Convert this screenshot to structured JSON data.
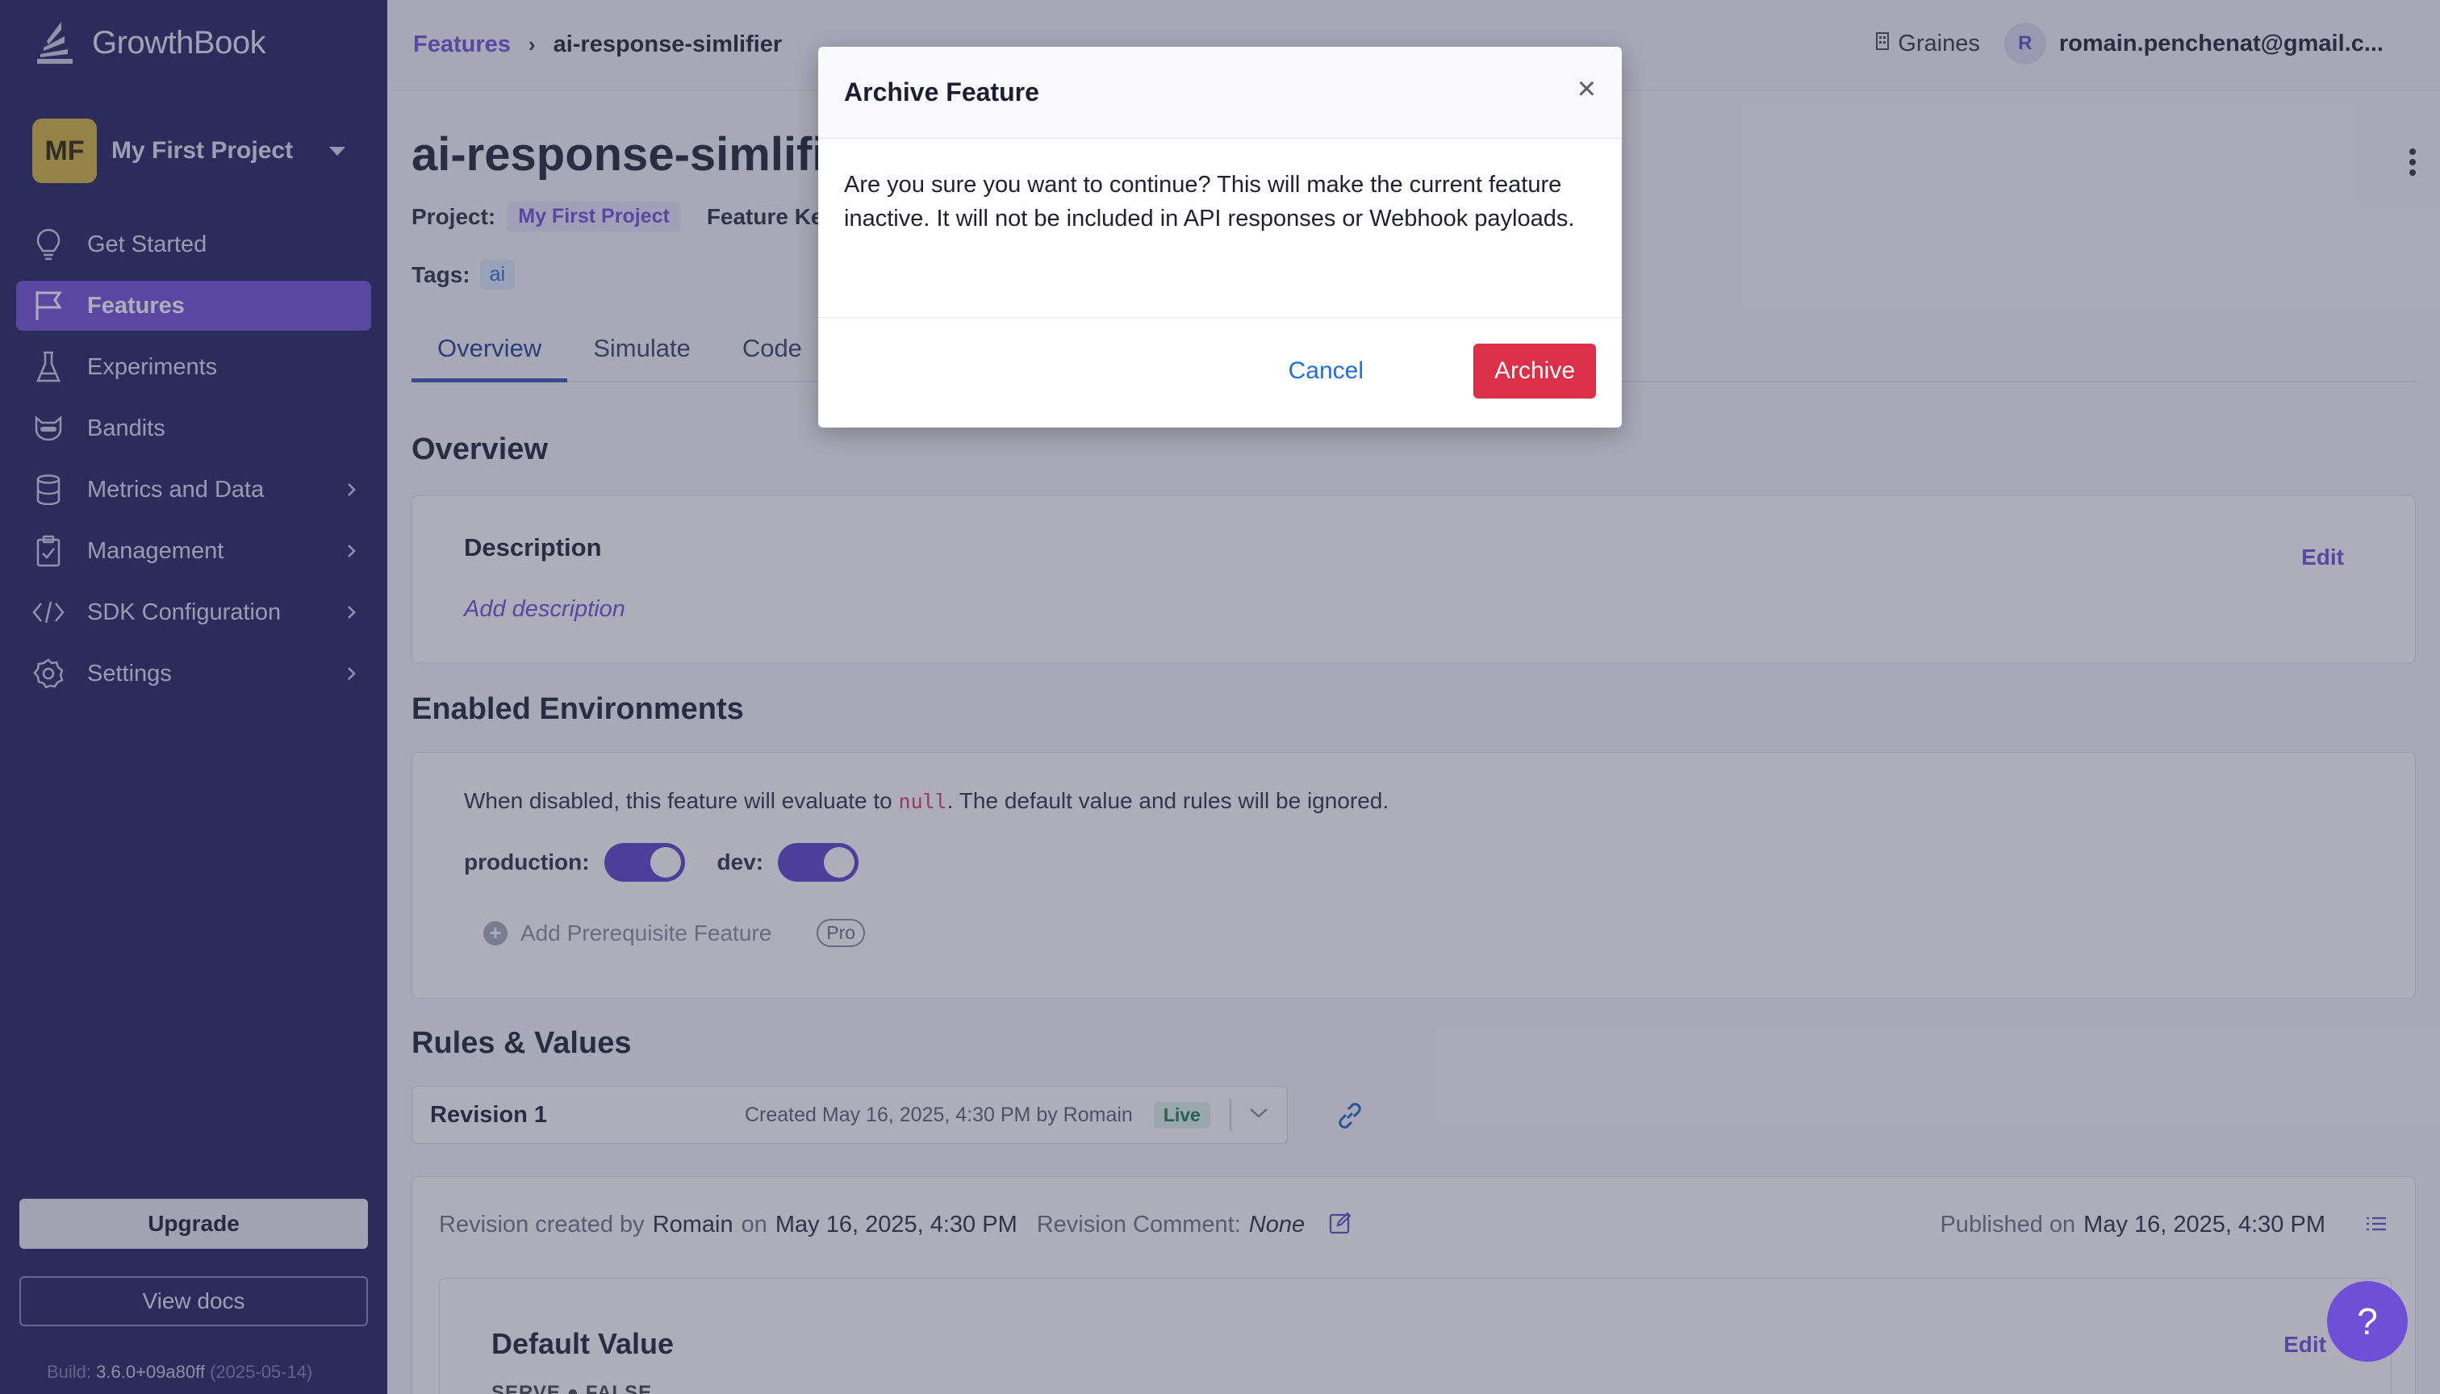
{
  "sidebar": {
    "logo_text": "GrowthBook",
    "project_initials": "MF",
    "project_name": "My First Project",
    "items": [
      {
        "label": "Get Started"
      },
      {
        "label": "Features"
      },
      {
        "label": "Experiments"
      },
      {
        "label": "Bandits"
      },
      {
        "label": "Metrics and Data"
      },
      {
        "label": "Management"
      },
      {
        "label": "SDK Configuration"
      },
      {
        "label": "Settings"
      }
    ],
    "upgrade_label": "Upgrade",
    "docs_label": "View docs",
    "build_prefix": "Build:",
    "build_version": "3.6.0+09a80ff",
    "build_date": "(2025-05-14)"
  },
  "topbar": {
    "breadcrumb_root": "Features",
    "breadcrumb_current": "ai-response-simlifier",
    "org_name": "Graines",
    "user_initial": "R",
    "user_email": "romain.penchenat@gmail.c..."
  },
  "feature": {
    "title": "ai-response-simlifi",
    "project_label": "Project:",
    "project_value": "My First Project",
    "feature_key_label": "Feature Key",
    "tags_label": "Tags:",
    "tags": [
      "ai"
    ]
  },
  "tabs": [
    {
      "label": "Overview"
    },
    {
      "label": "Simulate"
    },
    {
      "label": "Code"
    }
  ],
  "overview": {
    "section_title": "Overview",
    "description_title": "Description",
    "description_placeholder": "Add description",
    "edit_label": "Edit"
  },
  "environments": {
    "section_title": "Enabled Environments",
    "text_before": "When disabled, this feature will evaluate to ",
    "null_code": "null",
    "text_after": ". The default value and rules will be ignored.",
    "env1_label": "production:",
    "env2_label": "dev:",
    "prereq_label": "Add Prerequisite Feature",
    "pro_label": "Pro"
  },
  "rules": {
    "section_title": "Rules & Values",
    "revision_name": "Revision 1",
    "revision_created": "Created May 16, 2025, 4:30 PM by Romain",
    "live_label": "Live",
    "rev_created_by": "Revision created by",
    "rev_author": "Romain",
    "rev_on": "on",
    "rev_date": "May 16, 2025, 4:30 PM",
    "rev_comment_label": "Revision Comment:",
    "rev_comment_value": "None",
    "published_on_label": "Published on",
    "published_date": "May 16, 2025, 4:30 PM",
    "default_value_title": "Default Value",
    "default_edit": "Edit",
    "serve_text": "SERVE   ● FALSE"
  },
  "help_label": "?",
  "modal": {
    "title": "Archive Feature",
    "close_glyph": "×",
    "body": "Are you sure you want to continue? This will make the current feature inactive. It will not be included in API responses or Webhook payloads.",
    "cancel_label": "Cancel",
    "archive_label": "Archive"
  },
  "colors": {
    "sidebar_bg": "#1f1f5c",
    "accent": "#6e4fd6",
    "danger": "#dc2f48",
    "link_blue": "#1f6fe0"
  }
}
